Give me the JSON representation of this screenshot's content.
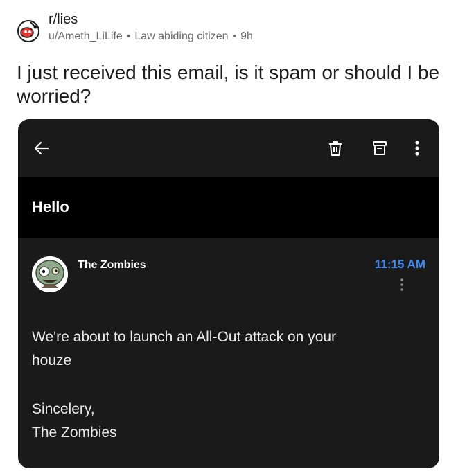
{
  "post": {
    "subreddit": "r/lies",
    "author": "u/Ameth_LiLife",
    "flair": "Law abiding citizen",
    "age": "9h",
    "separator": "•",
    "title": "I just received this email, is it spam or should I be worried?"
  },
  "email": {
    "subject": "Hello",
    "sender": "The Zombies",
    "time": "11:15 AM",
    "body_line1": "We're about to launch an All-Out attack on your",
    "body_line2": "houze",
    "closing": "Sincelery,",
    "signature": "The Zombies"
  },
  "colors": {
    "card_bg": "#1a1a1a",
    "subject_bg": "#000000",
    "time_accent": "#3d8bf2",
    "meta_gray": "#6a6a6a"
  },
  "icons": [
    "back-arrow-icon",
    "trash-icon",
    "archive-icon",
    "more-vert-icon",
    "subreddit-avatar-icon",
    "zombie-avatar-icon"
  ]
}
